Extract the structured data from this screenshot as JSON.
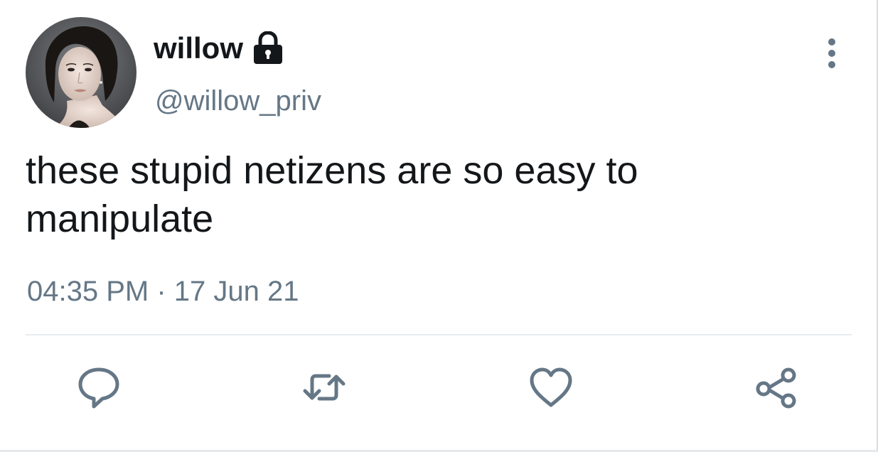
{
  "tweet": {
    "author": {
      "display_name": "willow",
      "handle": "@willow_priv",
      "protected_icon": "lock-icon",
      "avatar": "avatar-photo"
    },
    "text": "these stupid netizens are so easy to manipulate",
    "timestamp": "04:35 PM · 17 Jun 21",
    "menu_icon": "more-vertical-icon"
  },
  "actions": {
    "reply_icon": "reply-icon",
    "retweet_icon": "retweet-icon",
    "like_icon": "heart-icon",
    "share_icon": "share-icon"
  },
  "colors": {
    "text": "#14171a",
    "secondary": "#657786",
    "divider": "#e6ecf0"
  }
}
